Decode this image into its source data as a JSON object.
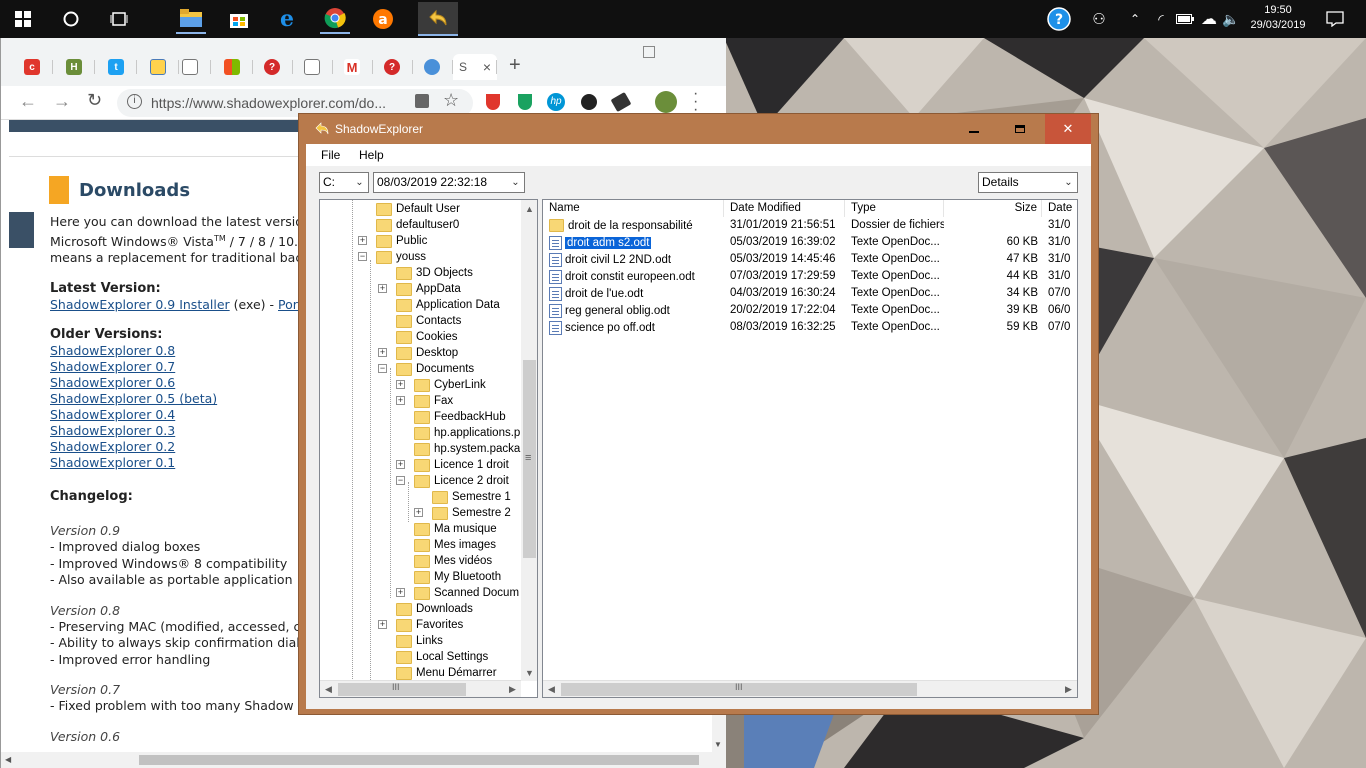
{
  "taskbar": {
    "clock_time": "19:50",
    "clock_date": "29/03/2019",
    "icons": [
      "windows-start-icon",
      "cortana-icon",
      "task-view-icon",
      "file-explorer-icon",
      "store-icon",
      "edge-icon",
      "chrome-icon",
      "avast-icon",
      "shadowexplorer-icon"
    ]
  },
  "chrome": {
    "url": "https://www.shadowexplorer.com/do...",
    "active_tab_initial": "S",
    "tab_close": "×",
    "new_tab": "+",
    "page": {
      "heading": "Downloads",
      "intro_1": "Here you can download the latest version",
      "intro_2a": "Microsoft Windows® Vista",
      "intro_2sup": "TM",
      "intro_2b": " / 7 / 8 / 10.",
      "intro_3": "means a replacement for traditional back",
      "latest_label": "Latest Version:",
      "latest_link": "ShadowExplorer 0.9 Installer",
      "latest_rest": " (exe) - ",
      "latest_link2": "Port",
      "older_label": "Older Versions:",
      "older": [
        "ShadowExplorer 0.8",
        "ShadowExplorer 0.7",
        "ShadowExplorer 0.6",
        "ShadowExplorer 0.5 (beta)",
        "ShadowExplorer 0.4",
        "ShadowExplorer 0.3",
        "ShadowExplorer 0.2",
        "ShadowExplorer 0.1"
      ],
      "changelog_label": "Changelog:",
      "v09": "Version 0.9",
      "v09_items": [
        "- Improved dialog boxes",
        "- Improved Windows® 8 compatibility",
        "- Also available as portable application"
      ],
      "v08": "Version 0.8",
      "v08_items": [
        "- Preserving MAC (modified, accessed, cr",
        "- Ability to always skip confirmation dialo",
        "- Improved error handling"
      ],
      "v07": "Version 0.7",
      "v07_items": [
        "- Fixed problem with too many Shadow Copies"
      ],
      "v06": "Version 0.6"
    }
  },
  "shadowexplorer": {
    "title": "ShadowExplorer",
    "menu": [
      "File",
      "Help"
    ],
    "drive": "C:",
    "snapshot": "08/03/2019 22:32:18",
    "view": "Details",
    "tree": [
      {
        "label": "Default User",
        "level": 2,
        "expander": false
      },
      {
        "label": "defaultuser0",
        "level": 2,
        "expander": false
      },
      {
        "label": "Public",
        "level": 2,
        "expander": "+"
      },
      {
        "label": "youss",
        "level": 2,
        "expander": "-"
      },
      {
        "label": "3D Objects",
        "level": 3,
        "expander": false
      },
      {
        "label": "AppData",
        "level": 3,
        "expander": "+"
      },
      {
        "label": "Application Data",
        "level": 3,
        "expander": false
      },
      {
        "label": "Contacts",
        "level": 3,
        "expander": false
      },
      {
        "label": "Cookies",
        "level": 3,
        "expander": false
      },
      {
        "label": "Desktop",
        "level": 3,
        "expander": "+"
      },
      {
        "label": "Documents",
        "level": 3,
        "expander": "-"
      },
      {
        "label": "CyberLink",
        "level": 4,
        "expander": "+"
      },
      {
        "label": "Fax",
        "level": 4,
        "expander": "+"
      },
      {
        "label": "FeedbackHub",
        "level": 4,
        "expander": false
      },
      {
        "label": "hp.applications.p",
        "level": 4,
        "expander": false
      },
      {
        "label": "hp.system.packa",
        "level": 4,
        "expander": false
      },
      {
        "label": "Licence 1 droit",
        "level": 4,
        "expander": "+"
      },
      {
        "label": "Licence 2 droit",
        "level": 4,
        "expander": "-"
      },
      {
        "label": "Semestre 1",
        "level": 5,
        "expander": false
      },
      {
        "label": "Semestre 2",
        "level": 5,
        "expander": "+"
      },
      {
        "label": "Ma musique",
        "level": 4,
        "expander": false
      },
      {
        "label": "Mes images",
        "level": 4,
        "expander": false
      },
      {
        "label": "Mes vidéos",
        "level": 4,
        "expander": false
      },
      {
        "label": "My Bluetooth",
        "level": 4,
        "expander": false
      },
      {
        "label": "Scanned Docum",
        "level": 4,
        "expander": "+"
      },
      {
        "label": "Downloads",
        "level": 3,
        "expander": false
      },
      {
        "label": "Favorites",
        "level": 3,
        "expander": "+"
      },
      {
        "label": "Links",
        "level": 3,
        "expander": false
      },
      {
        "label": "Local Settings",
        "level": 3,
        "expander": false
      },
      {
        "label": "Menu Démarrer",
        "level": 3,
        "expander": false
      }
    ],
    "columns": [
      "Name",
      "Date Modified",
      "Type",
      "Size",
      "Date"
    ],
    "files": [
      {
        "name": "droit de la responsabilité",
        "modified": "31/01/2019 21:56:51",
        "type": "Dossier de fichiers",
        "size": "",
        "date": "31/0",
        "folder": true
      },
      {
        "name": "droit adm s2.odt",
        "modified": "05/03/2019 16:39:02",
        "type": "Texte OpenDoc...",
        "size": "60 KB",
        "date": "31/0",
        "selected": true
      },
      {
        "name": "droit civil L2 2ND.odt",
        "modified": "05/03/2019 14:45:46",
        "type": "Texte OpenDoc...",
        "size": "47 KB",
        "date": "31/0"
      },
      {
        "name": "droit constit europeen.odt",
        "modified": "07/03/2019 17:29:59",
        "type": "Texte OpenDoc...",
        "size": "44 KB",
        "date": "31/0"
      },
      {
        "name": "droit de l'ue.odt",
        "modified": "04/03/2019 16:30:24",
        "type": "Texte OpenDoc...",
        "size": "34 KB",
        "date": "07/0"
      },
      {
        "name": "reg general oblig.odt",
        "modified": "20/02/2019 17:22:04",
        "type": "Texte OpenDoc...",
        "size": "39 KB",
        "date": "06/0"
      },
      {
        "name": "science po off.odt",
        "modified": "08/03/2019 16:32:25",
        "type": "Texte OpenDoc...",
        "size": "59 KB",
        "date": "07/0"
      }
    ]
  }
}
